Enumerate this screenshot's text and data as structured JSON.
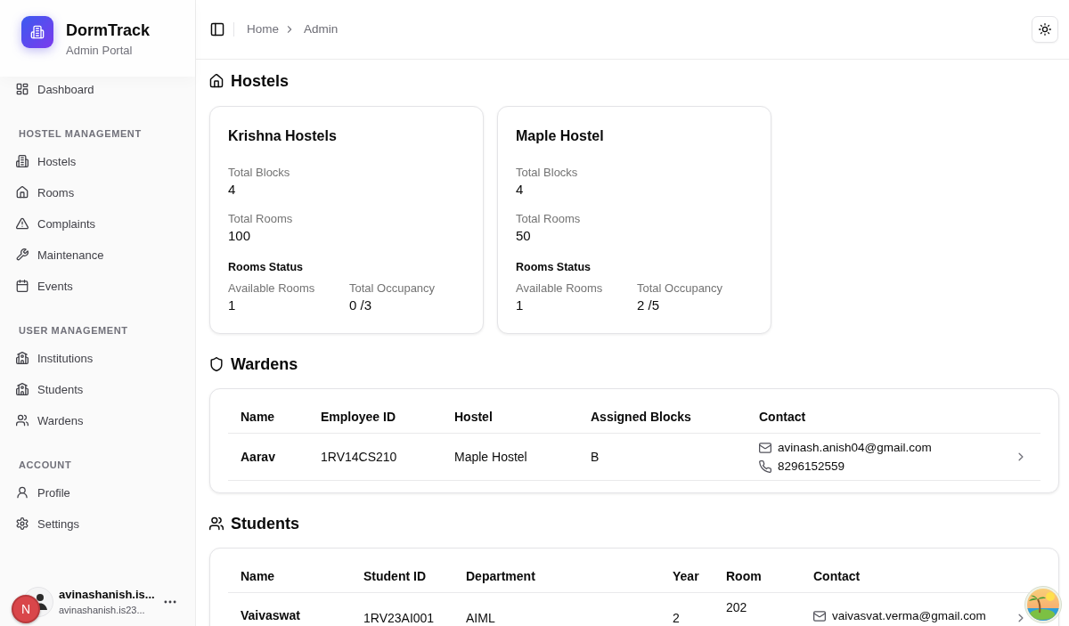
{
  "sidebar": {
    "brand": {
      "name": "DormTrack",
      "subtitle": "Admin Portal"
    },
    "groups": [
      {
        "items": [
          {
            "label": "Dashboard",
            "selected": false
          }
        ]
      },
      {
        "heading": "HOSTEL MANAGEMENT",
        "items": [
          {
            "label": "Hostels",
            "selected": false
          },
          {
            "label": "Rooms",
            "selected": false
          },
          {
            "label": "Complaints",
            "selected": false
          },
          {
            "label": "Maintenance",
            "selected": false
          },
          {
            "label": "Events",
            "selected": false
          }
        ]
      },
      {
        "heading": "USER MANAGEMENT",
        "items": [
          {
            "label": "Institutions",
            "selected": false
          },
          {
            "label": "Students",
            "selected": false
          },
          {
            "label": "Wardens",
            "selected": false
          }
        ]
      },
      {
        "heading": "ACCOUNT",
        "items": [
          {
            "label": "Profile",
            "selected": false
          },
          {
            "label": "Settings",
            "selected": false
          }
        ]
      }
    ],
    "user": {
      "name": "avinashanish.is...",
      "email": "avinashanish.is23..."
    }
  },
  "dev_tools_button": {
    "label": "N"
  },
  "topbar": {
    "breadcrumb": [
      "Home",
      "Admin"
    ]
  },
  "hostels": {
    "title": "Hostels",
    "cards": [
      {
        "name": "Krishna Hostels",
        "stats": [
          {
            "label": "Total Blocks",
            "value": "4"
          },
          {
            "label": "Total Rooms",
            "value": "100"
          }
        ],
        "status_title": "Rooms Status",
        "status": [
          {
            "label": "Available Rooms",
            "value": "1"
          },
          {
            "label": "Total Occupancy",
            "value": "0 /3"
          }
        ]
      },
      {
        "name": "Maple Hostel",
        "stats": [
          {
            "label": "Total Blocks",
            "value": "4"
          },
          {
            "label": "Total Rooms",
            "value": "50"
          }
        ],
        "status_title": "Rooms Status",
        "status": [
          {
            "label": "Available Rooms",
            "value": "1"
          },
          {
            "label": "Total Occupancy",
            "value": "2 /5"
          }
        ]
      }
    ]
  },
  "wardens": {
    "title": "Wardens",
    "columns": [
      "Name",
      "Employee ID",
      "Hostel",
      "Assigned Blocks",
      "Contact"
    ],
    "rows": [
      {
        "name": "Aarav",
        "employee_id": "1RV14CS210",
        "hostel": "Maple Hostel",
        "assigned_blocks": "B",
        "email": "avinash.anish04@gmail.com",
        "phone": "8296152559"
      }
    ]
  },
  "students": {
    "title": "Students",
    "columns": [
      "Name",
      "Student ID",
      "Department",
      "Year",
      "Room",
      "Contact"
    ],
    "rows": [
      {
        "name": "Vaivaswat",
        "student_id": "1RV23AI001",
        "department": "AIML",
        "year": "2",
        "room": "202",
        "email": "vaivasvat.verma@gmail.com"
      }
    ]
  }
}
